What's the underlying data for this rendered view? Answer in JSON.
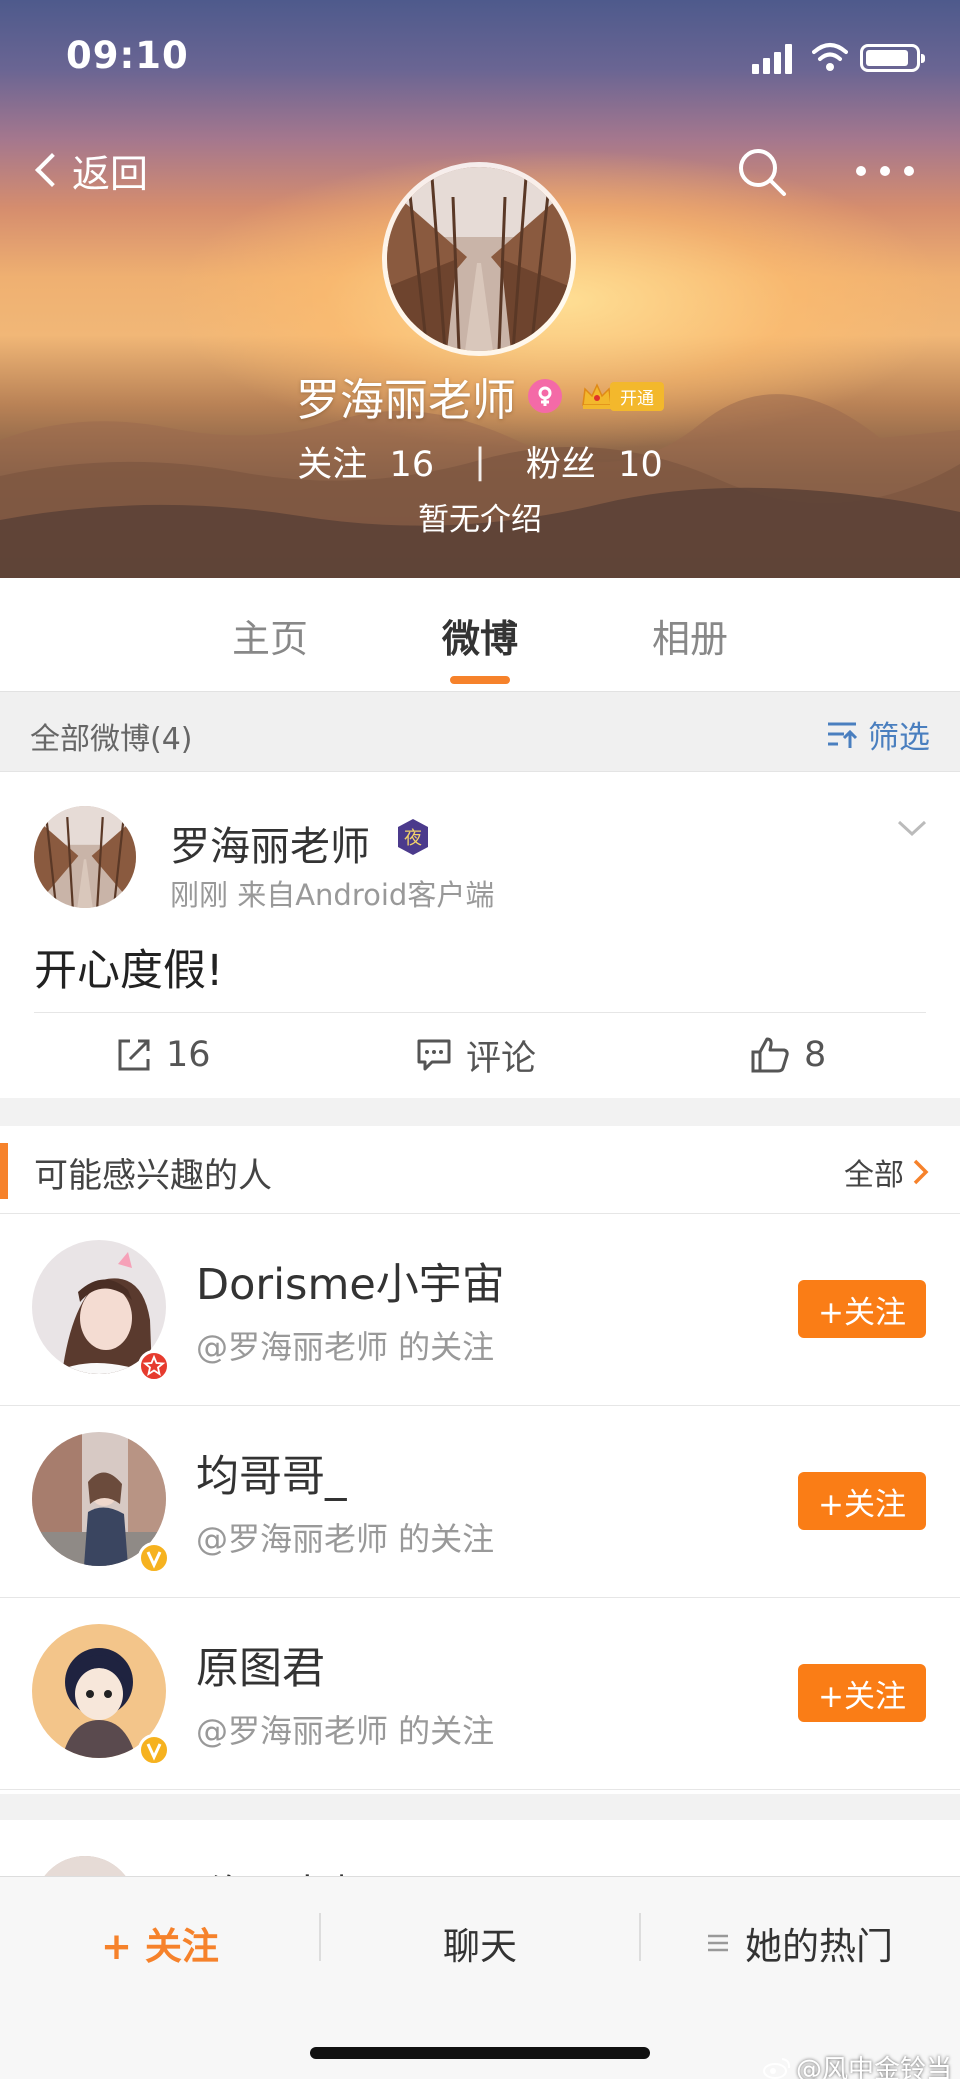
{
  "status_bar": {
    "time": "09:10"
  },
  "nav": {
    "back_label": "返回"
  },
  "profile": {
    "name": "罗海丽老师",
    "vip_label": "开通",
    "following_label": "关注",
    "following_count": "16",
    "divider": "|",
    "followers_label": "粉丝",
    "followers_count": "10",
    "bio": "暂无介绍"
  },
  "tabs": [
    {
      "label": "主页"
    },
    {
      "label": "微博"
    },
    {
      "label": "相册"
    }
  ],
  "feed_bar": {
    "label": "全部微博(4)",
    "filter_label": "筛选"
  },
  "post": {
    "author": "罗海丽老师",
    "badge_text": "夜",
    "meta": "刚刚  来自Android客户端",
    "text": "开心度假!",
    "repost_count": "16",
    "comment_label": "评论",
    "like_count": "8"
  },
  "recommend": {
    "title": "可能感兴趣的人",
    "all_label": "全部",
    "follow_button": "+关注",
    "users": [
      {
        "name": "Dorisme小宇宙",
        "sub": "@罗海丽老师 的关注",
        "badge": "star"
      },
      {
        "name": "均哥哥_",
        "sub": "@罗海丽老师 的关注",
        "badge": "v"
      },
      {
        "name": "原图君",
        "sub": "@罗海丽老师 的关注",
        "badge": "v"
      }
    ]
  },
  "post2": {
    "author": "罗海丽老师"
  },
  "bottom_bar": {
    "follow_label": "+ 关注",
    "chat_label": "聊天",
    "hot_label": "她的热门"
  },
  "watermark": "@风中金铃当",
  "colors": {
    "accent": "#f6822b",
    "follow_button": "#fa7d16",
    "link_blue": "#4a7fbf",
    "vip_gold": "#f3b82c",
    "female_pink": "#f46aa7"
  }
}
